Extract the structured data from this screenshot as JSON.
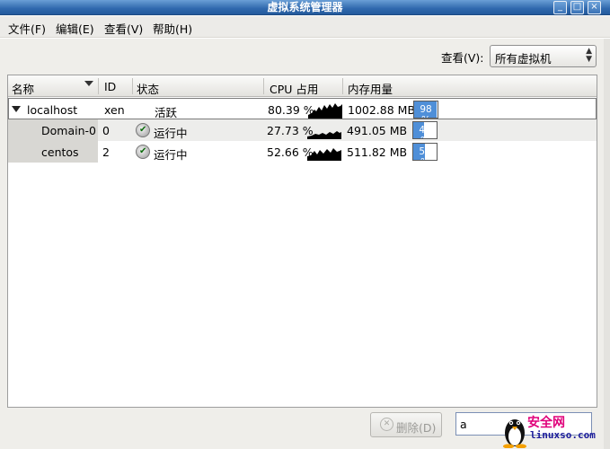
{
  "window": {
    "title": "虚拟系统管理器",
    "controls": {
      "minimize": "_",
      "maximize": "□",
      "close": "×"
    }
  },
  "menu": [
    {
      "label": "文件(F)"
    },
    {
      "label": "编辑(E)"
    },
    {
      "label": "查看(V)"
    },
    {
      "label": "帮助(H)"
    }
  ],
  "view_filter": {
    "label": "查看(V):",
    "selected": "所有虚拟机"
  },
  "table": {
    "columns": [
      "名称",
      "ID",
      "状态",
      "CPU 占用",
      "内存用量"
    ],
    "rows": [
      {
        "name": "localhost",
        "id": "xen",
        "status": "活跃",
        "cpu": "80.39 %",
        "memory": "1002.88 MB",
        "mem_pct": "98 %",
        "mem_fill": 98
      },
      {
        "name": "Domain-0",
        "id": "0",
        "status": "运行中",
        "cpu": "27.73 %",
        "memory": "491.05 MB",
        "mem_pct": "48 %",
        "mem_fill": 48
      },
      {
        "name": "centos",
        "id": "2",
        "status": "运行中",
        "cpu": "52.66 %",
        "memory": "511.82 MB",
        "mem_pct": "50 %",
        "mem_fill": 50
      }
    ]
  },
  "actions": {
    "delete_label": "删除(D)"
  },
  "search": {
    "value": "a"
  },
  "watermark": {
    "text_cn": "安全网",
    "text_url": "linuxso.com"
  },
  "colors": {
    "titlebar": "#2f68ad",
    "selection": "#4f8fd8",
    "background": "#efeeea"
  }
}
